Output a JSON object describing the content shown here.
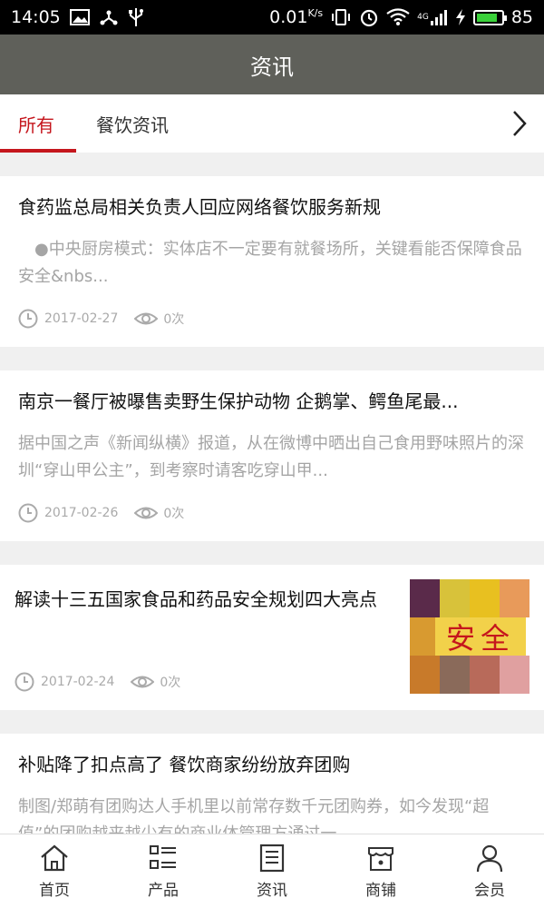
{
  "status": {
    "time": "14:05",
    "speed": "0.01",
    "speed_unit": "K/s",
    "network": "4G",
    "battery": "85",
    "battery_level": 0.85
  },
  "header": {
    "title": "资讯"
  },
  "tabs": [
    {
      "label": "所有",
      "active": true
    },
    {
      "label": "餐饮资讯",
      "active": false
    }
  ],
  "articles": [
    {
      "title": "食药监总局相关负责人回应网络餐饮服务新规",
      "summary": "　●中央厨房模式：实体店不一定要有就餐场所，关键看能否保障食品安全&nbs...",
      "date": "2017-02-27",
      "views": "0次"
    },
    {
      "title": "南京一餐厅被曝售卖野生保护动物 企鹅掌、鳄鱼尾最...",
      "summary": "据中国之声《新闻纵横》报道，从在微博中晒出自己食用野味照片的深圳“穿山甲公主”，到考察时请客吃穿山甲...",
      "date": "2017-02-26",
      "views": "0次"
    },
    {
      "title": "解读十三五国家食品和药品安全规划四大亮点",
      "date": "2017-02-24",
      "views": "0次",
      "thumb_text": "安全"
    },
    {
      "title": "补贴降了扣点高了 餐饮商家纷纷放弃团购",
      "summary": "制图/郑萌有团购达人手机里以前常存数千元团购券，如今发现“超值”的团购越来越少有的商业体管理方通过一..."
    }
  ],
  "bottom_nav": [
    {
      "label": "首页",
      "icon": "home-icon"
    },
    {
      "label": "产品",
      "icon": "list-icon"
    },
    {
      "label": "资讯",
      "icon": "news-icon"
    },
    {
      "label": "商铺",
      "icon": "shop-icon"
    },
    {
      "label": "会员",
      "icon": "user-icon"
    }
  ],
  "colors": {
    "accent": "#c5161d",
    "header_bg": "#5f605a",
    "battery_fill": "#3ad13a"
  }
}
